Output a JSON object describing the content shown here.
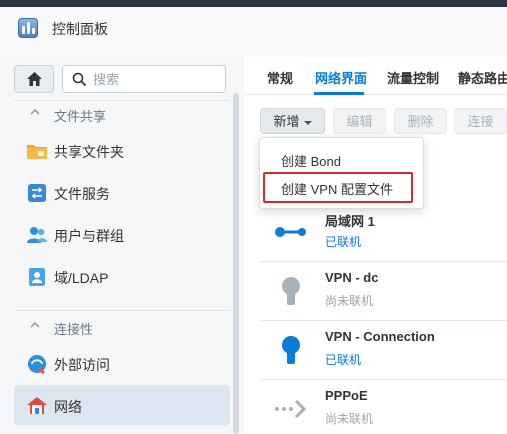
{
  "window": {
    "title": "控制面板"
  },
  "sidebar": {
    "search_placeholder": "搜索",
    "sections": [
      {
        "label": "文件共享"
      },
      {
        "label": "连接性"
      }
    ],
    "items": [
      {
        "label": "共享文件夹",
        "icon": "folder-share-icon"
      },
      {
        "label": "文件服务",
        "icon": "file-services-icon"
      },
      {
        "label": "用户与群组",
        "icon": "users-icon"
      },
      {
        "label": "域/LDAP",
        "icon": "domain-ldap-icon"
      },
      {
        "label": "外部访问",
        "icon": "external-access-icon"
      },
      {
        "label": "网络",
        "icon": "network-house-icon",
        "active": true
      }
    ]
  },
  "tabs": [
    {
      "label": "常规"
    },
    {
      "label": "网络界面",
      "active": true
    },
    {
      "label": "流量控制"
    },
    {
      "label": "静态路由"
    }
  ],
  "toolbar": {
    "new_label": "新增",
    "edit_label": "编辑",
    "delete_label": "删除",
    "connect_label": "连接"
  },
  "dropdown": {
    "items": [
      {
        "label": "创建 Bond"
      },
      {
        "label": "创建 VPN 配置文件"
      }
    ]
  },
  "interfaces": [
    {
      "name": "局域网 1",
      "status": "已联机",
      "connected": true,
      "icon": "lan-icon"
    },
    {
      "name": "VPN - dc",
      "status": "尚未联机",
      "connected": false,
      "icon": "vpn-icon"
    },
    {
      "name": "VPN - Connection",
      "status": "已联机",
      "connected": true,
      "icon": "vpn-icon"
    },
    {
      "name": "PPPoE",
      "status": "尚未联机",
      "connected": false,
      "icon": "pppoe-icon"
    }
  ],
  "colors": {
    "accent": "#0a7bd6",
    "highlight_box": "#d9262c",
    "inactive_gray": "#9aa4ae"
  }
}
